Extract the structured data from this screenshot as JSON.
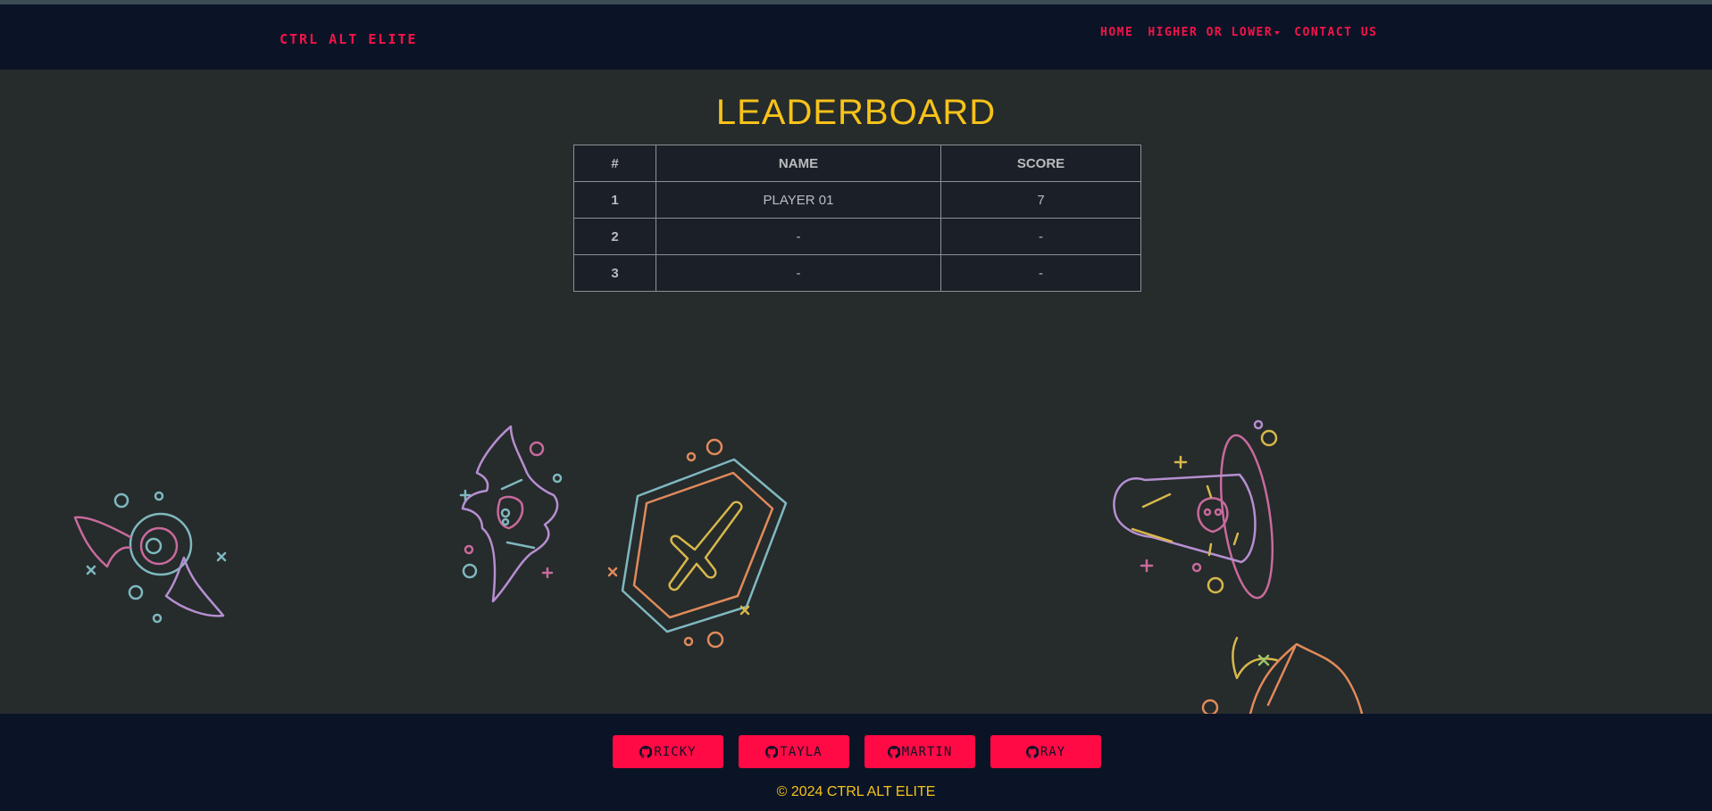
{
  "navbar": {
    "brand": "CTRL ALT ELITE",
    "links": [
      {
        "label": "HOME"
      },
      {
        "label": "HIGHER OR LOWER"
      },
      {
        "label": "CONTACT US"
      }
    ]
  },
  "main": {
    "title": "LEADERBOARD",
    "table": {
      "headers": [
        "#",
        "NAME",
        "SCORE"
      ],
      "rows": [
        [
          "1",
          "PLAYER 01",
          "7"
        ],
        [
          "2",
          "-",
          "-"
        ],
        [
          "3",
          "-",
          "-"
        ]
      ]
    }
  },
  "footer": {
    "buttons": [
      {
        "label": "RICKY",
        "icon": "github-icon"
      },
      {
        "label": "TAYLA",
        "icon": "github-icon"
      },
      {
        "label": "MARTIN",
        "icon": "github-icon"
      },
      {
        "label": "RAY",
        "icon": "github-icon"
      }
    ],
    "copyright": "© 2024 CTRL ALT ELITE"
  },
  "colors": {
    "navbar_bg": "#0b1426",
    "page_bg": "#262b2c",
    "accent_red": "#f5134a",
    "title_yellow": "#f7c21a",
    "button_red": "#ff0a45"
  }
}
